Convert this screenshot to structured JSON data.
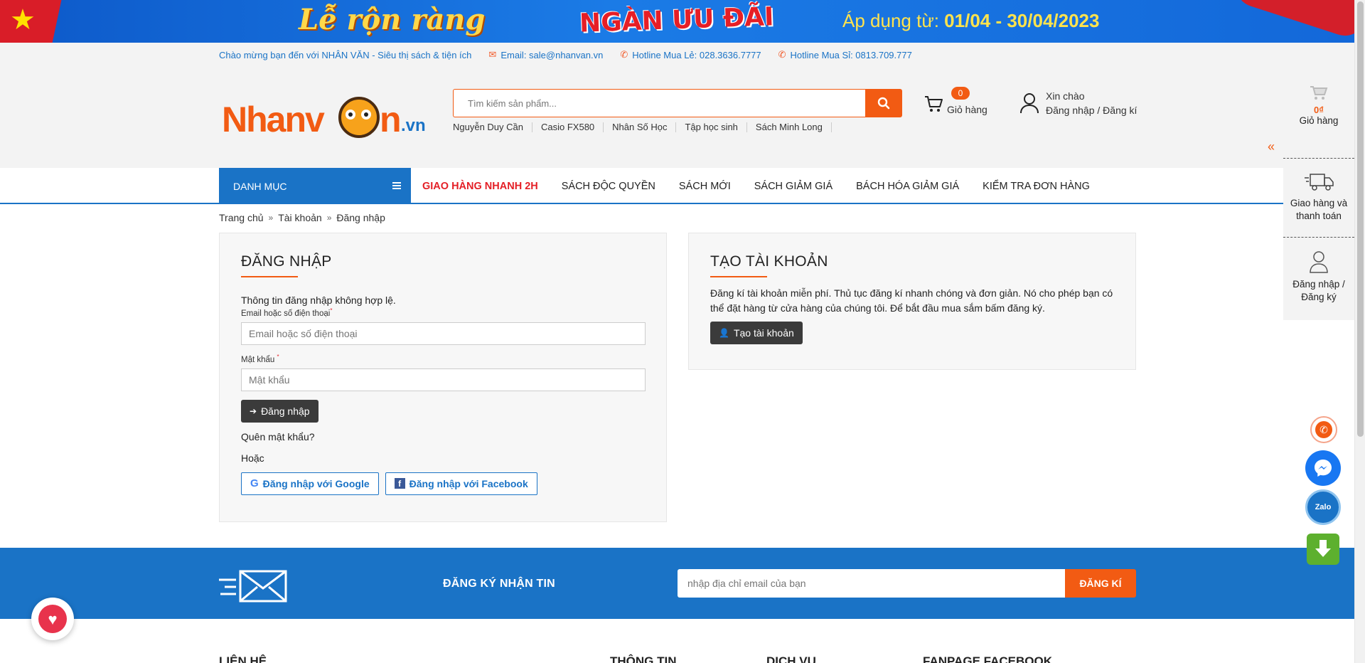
{
  "banner": {
    "title_left": "Lễ rộn ràng",
    "title_mid": "NGÀN ƯU ĐÃI",
    "date_prefix": "Áp dụng từ: ",
    "date_range": "01/04 - 30/04/2023"
  },
  "topbar": {
    "welcome": "Chào mừng bạn đến với NHÂN VĂN - Siêu thị sách & tiện ích",
    "email": "Email: sale@nhanvan.vn",
    "hotline_retail": "Hotline Mua Lẻ: 028.3636.7777",
    "hotline_wholesale": "Hotline Mua Sỉ: 0813.709.777"
  },
  "logo": {
    "part1": "Nhanv",
    "part2": "n",
    "suffix": ".vn"
  },
  "search": {
    "placeholder": "Tìm kiếm sản phẩm...",
    "keywords": [
      "Nguyễn Duy Cần",
      "Casio FX580",
      "Nhân Số Học",
      "Tập học sinh",
      "Sách Minh Long"
    ]
  },
  "cart": {
    "count": "0",
    "label": "Giỏ hàng"
  },
  "account": {
    "greeting": "Xin chào",
    "link": "Đăng nhập / Đăng kí"
  },
  "nav": {
    "category": "DANH MỤC",
    "links": [
      "GIAO HÀNG NHANH 2H",
      "SÁCH ĐỘC QUYỀN",
      "SÁCH MỚI",
      "SÁCH GIẢM GIÁ",
      "BÁCH HÓA GIẢM GIÁ",
      "KIỂM TRA ĐƠN HÀNG"
    ]
  },
  "breadcrumb": [
    "Trang chủ",
    "Tài khoản",
    "Đăng nhập"
  ],
  "login": {
    "title": "ĐĂNG NHẬP",
    "error": "Thông tin đăng nhập không hợp lệ.",
    "email_label": "Email hoặc số điện thoại",
    "email_placeholder": "Email hoặc số điện thoại",
    "password_label": "Mật khẩu",
    "password_placeholder": "Mật khẩu",
    "submit": "Đăng nhập",
    "forgot": "Quên mật khẩu?",
    "or": "Hoặc",
    "google": "Đăng nhập với Google",
    "facebook": "Đăng nhập với Facebook"
  },
  "register": {
    "title": "TẠO TÀI KHOẢN",
    "description": "Đăng kí tài khoản miễn phí. Thủ tục đăng kí nhanh chóng và đơn giản. Nó cho phép bạn có thể đặt hàng từ cửa hàng của chúng tôi. Để bắt đầu mua sắm bấm đăng ký.",
    "button": "Tạo tài khoản"
  },
  "newsletter": {
    "title": "ĐĂNG KÝ NHẬN TIN",
    "placeholder": "nhập địa chỉ email của bạn",
    "button": "ĐĂNG KÍ"
  },
  "footer": {
    "columns": [
      "LIÊN HỆ",
      "THÔNG TIN",
      "DỊCH VỤ",
      "FANPAGE FACEBOOK"
    ]
  },
  "sidebar": {
    "cart_amount": "0₫",
    "cart_label": "Giỏ hàng",
    "shipping_label": "Giao hàng và thanh toán",
    "login_label": "Đăng nhập / Đăng ký"
  },
  "colors": {
    "brand_orange": "#f25b13",
    "brand_blue": "#1a73c6",
    "hot_red": "#e41f26"
  }
}
